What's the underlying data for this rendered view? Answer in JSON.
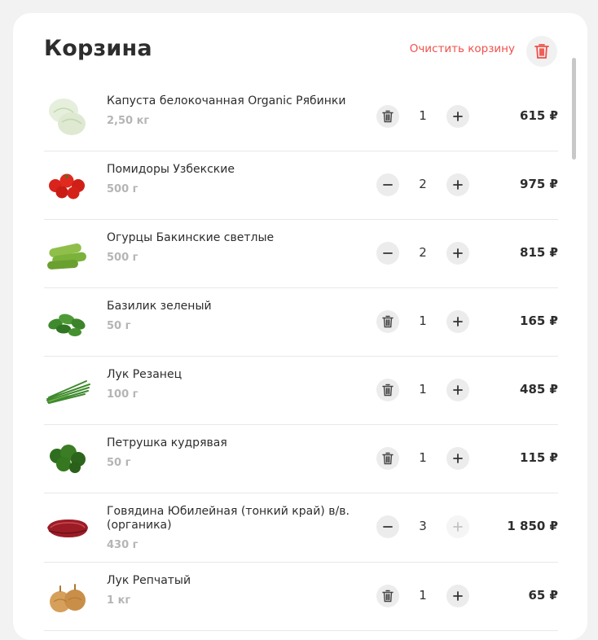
{
  "cart": {
    "title": "Корзина",
    "clear_label": "Очистить корзину",
    "colors": {
      "accent": "#f0504a",
      "button_bg": "#ececec",
      "muted_text": "#b5b5b5"
    },
    "items": [
      {
        "name": "Капуста белокочанная Organic Рябинки",
        "weight": "2,50 кг",
        "quantity": "1",
        "price": "615 ₽",
        "left_action": "trash-icon",
        "image": "cabbage"
      },
      {
        "name": "Помидоры Узбекские",
        "weight": "500 г",
        "quantity": "2",
        "price": "975 ₽",
        "left_action": "minus-icon",
        "image": "tomatoes"
      },
      {
        "name": "Огурцы Бакинские светлые",
        "weight": "500 г",
        "quantity": "2",
        "price": "815 ₽",
        "left_action": "minus-icon",
        "image": "cucumbers"
      },
      {
        "name": "Базилик зеленый",
        "weight": "50 г",
        "quantity": "1",
        "price": "165 ₽",
        "left_action": "trash-icon",
        "image": "basil"
      },
      {
        "name": "Лук Резанец",
        "weight": "100 г",
        "quantity": "1",
        "price": "485 ₽",
        "left_action": "trash-icon",
        "image": "chives"
      },
      {
        "name": "Петрушка кудрявая",
        "weight": "50 г",
        "quantity": "1",
        "price": "115 ₽",
        "left_action": "trash-icon",
        "image": "parsley"
      },
      {
        "name": "Говядина Юбилейная (тонкий край) в/в. (органика)",
        "weight": "430 г",
        "quantity": "3",
        "price": "1 850 ₽",
        "left_action": "minus-icon",
        "image": "beef",
        "plus_disabled": true
      },
      {
        "name": "Лук Репчатый",
        "weight": "1 кг",
        "quantity": "1",
        "price": "65 ₽",
        "left_action": "trash-icon",
        "image": "onions"
      }
    ]
  }
}
